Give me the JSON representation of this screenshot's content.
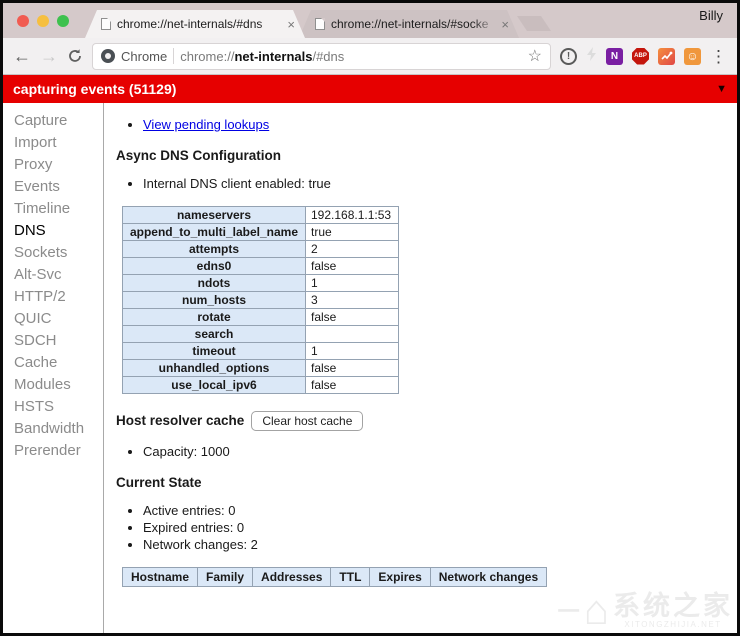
{
  "window": {
    "profile_name": "Billy"
  },
  "tabs": [
    {
      "title": "chrome://net-internals/#dns",
      "active": true
    },
    {
      "title": "chrome://net-internals/#socke",
      "active": false
    }
  ],
  "navbar": {
    "site_label": "Chrome",
    "url": {
      "prefix": "chrome://",
      "host": "net-internals",
      "suffix": "/#dns"
    },
    "ext_onenote_label": "N",
    "ext_abp_label": "ABP"
  },
  "banner": {
    "text": "capturing events (51129)"
  },
  "sidebar": {
    "items": [
      "Capture",
      "Import",
      "Proxy",
      "Events",
      "Timeline",
      "DNS",
      "Sockets",
      "Alt-Svc",
      "HTTP/2",
      "QUIC",
      "SDCH",
      "Cache",
      "Modules",
      "HSTS",
      "Bandwidth",
      "Prerender"
    ],
    "active_item": "DNS"
  },
  "main": {
    "pending_link": "View pending lookups",
    "async_heading": "Async DNS Configuration",
    "internal_dns_line": "Internal DNS client enabled: true",
    "config_table": {
      "rows": [
        {
          "label": "nameservers",
          "value": "192.168.1.1:53"
        },
        {
          "label": "append_to_multi_label_name",
          "value": "true"
        },
        {
          "label": "attempts",
          "value": "2"
        },
        {
          "label": "edns0",
          "value": "false"
        },
        {
          "label": "ndots",
          "value": "1"
        },
        {
          "label": "num_hosts",
          "value": "3"
        },
        {
          "label": "rotate",
          "value": "false"
        },
        {
          "label": "search",
          "value": ""
        },
        {
          "label": "timeout",
          "value": "1"
        },
        {
          "label": "unhandled_options",
          "value": "false"
        },
        {
          "label": "use_local_ipv6",
          "value": "false"
        }
      ]
    },
    "host_resolver_heading": "Host resolver cache",
    "clear_button_label": "Clear host cache",
    "capacity_line": "Capacity: 1000",
    "current_state_heading": "Current State",
    "state_items": [
      "Active entries: 0",
      "Expired entries: 0",
      "Network changes: 2"
    ],
    "entries_table": {
      "headers": [
        "Hostname",
        "Family",
        "Addresses",
        "TTL",
        "Expires",
        "Network changes"
      ]
    }
  },
  "watermark": {
    "dash": "一",
    "house": "⌂",
    "text": "系统之家",
    "subtext": "XITONGZHIJIA.NET"
  },
  "icons": {
    "back": "←",
    "forward": "→",
    "star": "☆",
    "info": "!",
    "menu": "⋮",
    "caret_down": "▼",
    "close": "×",
    "smiley": "☺"
  },
  "colors": {
    "banner_red": "#e60000",
    "table_header_blue": "#dbe8f7",
    "link_blue": "#0000e3"
  }
}
